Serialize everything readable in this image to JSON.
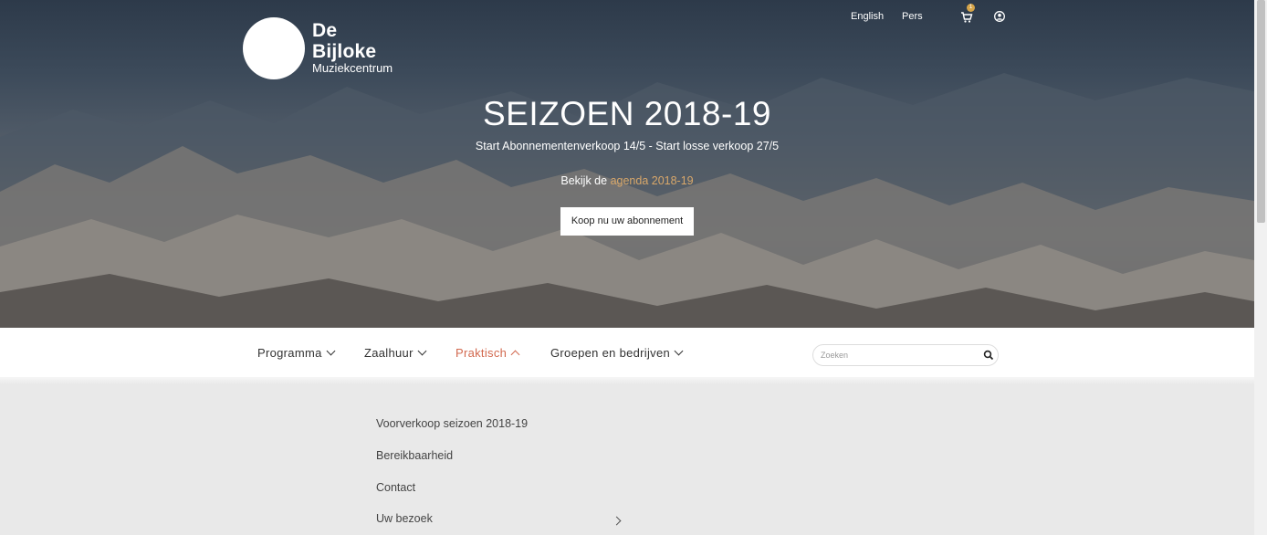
{
  "header": {
    "logo": {
      "line1": "De",
      "line2": "Bijloke",
      "line3": "Muziekcentrum"
    },
    "links": {
      "english": "English",
      "pers": "Pers"
    },
    "cart_count": "1"
  },
  "hero": {
    "title": "SEIZOEN 2018-19",
    "subtitle": "Start Abonnementenverkoop 14/5 - Start losse verkoop 27/5",
    "agenda_prefix": "Bekijk de ",
    "agenda_link": "agenda 2018-19",
    "cta_label": "Koop nu uw abonnement"
  },
  "nav": {
    "items": [
      {
        "label": "Programma"
      },
      {
        "label": "Zaalhuur"
      },
      {
        "label": "Praktisch"
      },
      {
        "label": "Groepen en bedrijven"
      }
    ],
    "active": "Praktisch",
    "search_placeholder": "Zoeken"
  },
  "submenu": {
    "items": [
      {
        "label": "Voorverkoop seizoen 2018-19"
      },
      {
        "label": "Bereikbaarheid"
      },
      {
        "label": "Contact"
      },
      {
        "label": "Uw bezoek"
      }
    ]
  },
  "colors": {
    "accent": "#d2694f",
    "link": "#d9a86a",
    "badge": "#d6a54a"
  }
}
